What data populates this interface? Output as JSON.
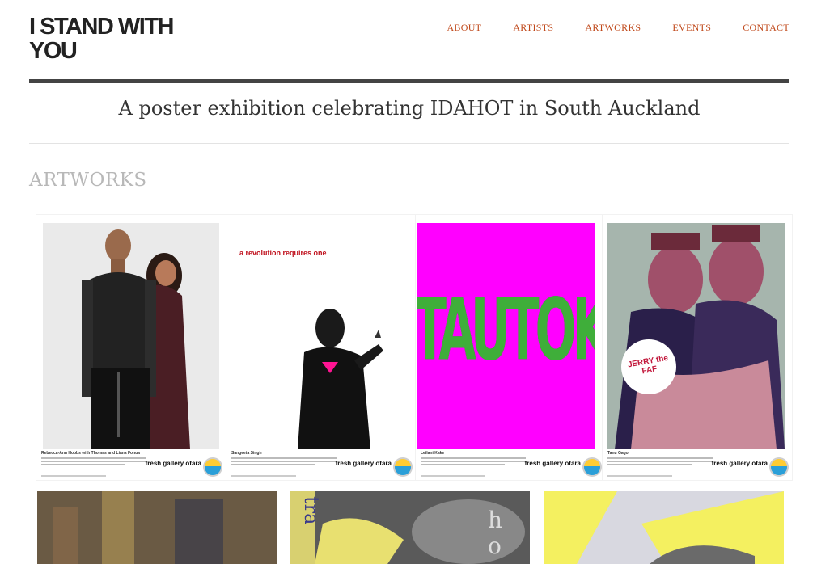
{
  "site": {
    "title": "I STAND WITH YOU"
  },
  "nav": {
    "items": [
      "ABOUT",
      "ARTISTS",
      "ARTWORKS",
      "EVENTS",
      "CONTACT"
    ]
  },
  "tagline": "A poster exhibition celebrating IDAHOT in South Auckland",
  "section": {
    "title": "ARTWORKS"
  },
  "posters": [
    {
      "artist": "Rebecca-Ann Hobbs with Thomas and Liana Fonua",
      "brand": "fresh gallery otara"
    },
    {
      "artist": "Sangeeta Singh",
      "headline": "a revolution requires one",
      "brand": "fresh gallery otara"
    },
    {
      "artist": "Leilani Kake",
      "word": "TAUTOKO",
      "brand": "fresh gallery otara"
    },
    {
      "artist": "Tanu Gago",
      "badge_text": "JERRY the FAF",
      "brand": "fresh gallery otara"
    }
  ],
  "row2": [
    {
      "text": ""
    },
    {
      "text_left": "tra",
      "text_right": "ho"
    },
    {
      "text": ""
    }
  ],
  "colors": {
    "nav": "#c0491b",
    "accent_pink": "#ff00ff",
    "rule": "#444444"
  }
}
